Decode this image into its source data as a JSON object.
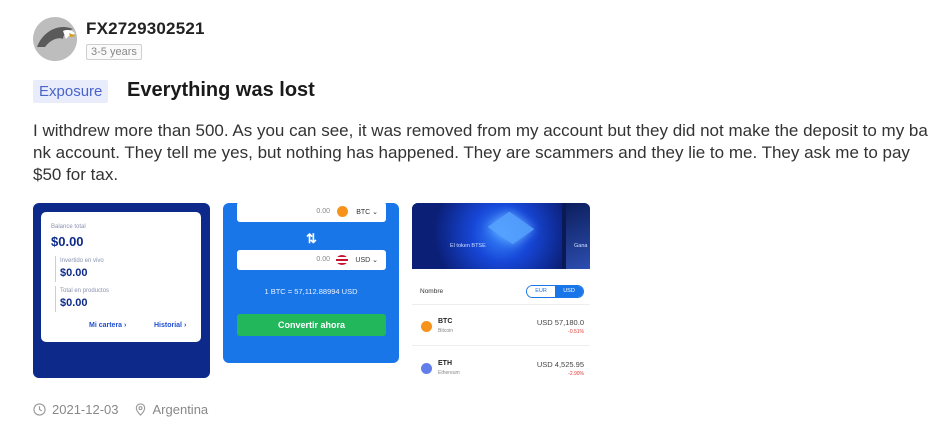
{
  "user": {
    "name": "FX2729302521",
    "experience": "3-5 years"
  },
  "post": {
    "tag": "Exposure",
    "title": "Everything was lost",
    "body": "I withdrew more than 500. As you can see, it was removed from my account but they did not make the deposit to my bank account. They tell me yes, but nothing has happened. They are scammers and they lie to me. They ask me to pay $50 for tax.",
    "date": "2021-12-03",
    "location": "Argentina"
  },
  "screenshot1": {
    "balance_total_label": "Balance total",
    "balance_total": "$0.00",
    "invested_label": "Invertido en vivo",
    "invested": "$0.00",
    "total_products_label": "Total en productos",
    "total_products": "$0.00",
    "wallet_link": "Mi cartera",
    "history_link": "Historial"
  },
  "screenshot2": {
    "from_amount": "0.00",
    "from_currency": "BTC",
    "to_amount": "0.00",
    "to_currency": "USD",
    "rate": "1 BTC = 57,112.88994 USD",
    "cta": "Convertir ahora",
    "colors": {
      "background": "#1976e8",
      "cta": "#23b75c"
    }
  },
  "screenshot3": {
    "banner_label": "El token BTSE",
    "banner_label_2": "Gana",
    "column_header": "Nombre",
    "toggle": [
      "EUR",
      "USD"
    ],
    "rows": [
      {
        "symbol": "BTC",
        "name": "Bitcoin",
        "price": "USD 57,180.0",
        "change": "-0.51%",
        "icon": "bitcoin-icon",
        "color": "#f7931a"
      },
      {
        "symbol": "ETH",
        "name": "Ethereum",
        "price": "USD 4,525.95",
        "change": "-2.90%",
        "icon": "ethereum-icon",
        "color": "#627eea"
      }
    ]
  },
  "footer_icons": [
    "clock-icon",
    "location-pin-icon"
  ]
}
